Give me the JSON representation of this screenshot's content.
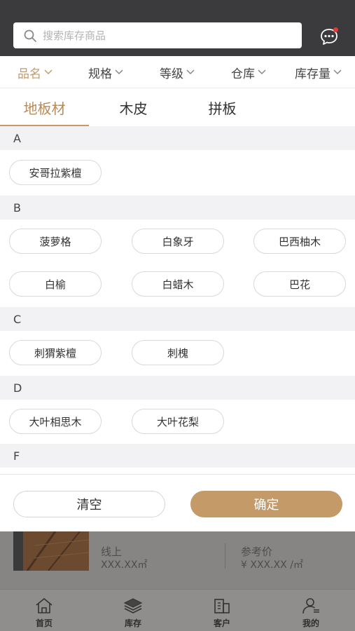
{
  "header": {
    "search_placeholder": "搜索库存商品",
    "search_icon": "search-icon",
    "message_icon": "chat-bubble-icon",
    "message_badge_color": "#e0393e"
  },
  "filters": [
    {
      "label": "品名",
      "active": true
    },
    {
      "label": "规格",
      "active": false
    },
    {
      "label": "等级",
      "active": false
    },
    {
      "label": "仓库",
      "active": false
    },
    {
      "label": "库存量",
      "active": false
    }
  ],
  "tabs": [
    {
      "label": "地板材",
      "active": true
    },
    {
      "label": "木皮",
      "active": false
    },
    {
      "label": "拼板",
      "active": false
    }
  ],
  "groups": [
    {
      "letter": "A",
      "items": [
        "安哥拉紫檀"
      ]
    },
    {
      "letter": "B",
      "items": [
        "菠萝格",
        "白象牙",
        "巴西柚木",
        "白榆",
        "白蜡木",
        "巴花"
      ]
    },
    {
      "letter": "C",
      "items": [
        "刺猬紫檀",
        "刺槐"
      ]
    },
    {
      "letter": "D",
      "items": [
        "大叶相思木",
        "大叶花梨"
      ]
    },
    {
      "letter": "F",
      "items": []
    }
  ],
  "actions": {
    "clear": "清空",
    "confirm": "确定"
  },
  "product": {
    "line_label": "线上",
    "line_value": "XXX.XX㎡",
    "ref_label": "参考价",
    "ref_value": "¥ XXX.XX /㎡"
  },
  "bottom_nav": [
    {
      "label": "首页",
      "icon": "home-icon"
    },
    {
      "label": "库存",
      "icon": "layers-icon",
      "active": true
    },
    {
      "label": "客户",
      "icon": "building-icon"
    },
    {
      "label": "我的",
      "icon": "user-icon"
    }
  ],
  "colors": {
    "accent": "#c39a68",
    "topbar": "#3b3b3d",
    "section_bg": "#f2f2f4"
  }
}
